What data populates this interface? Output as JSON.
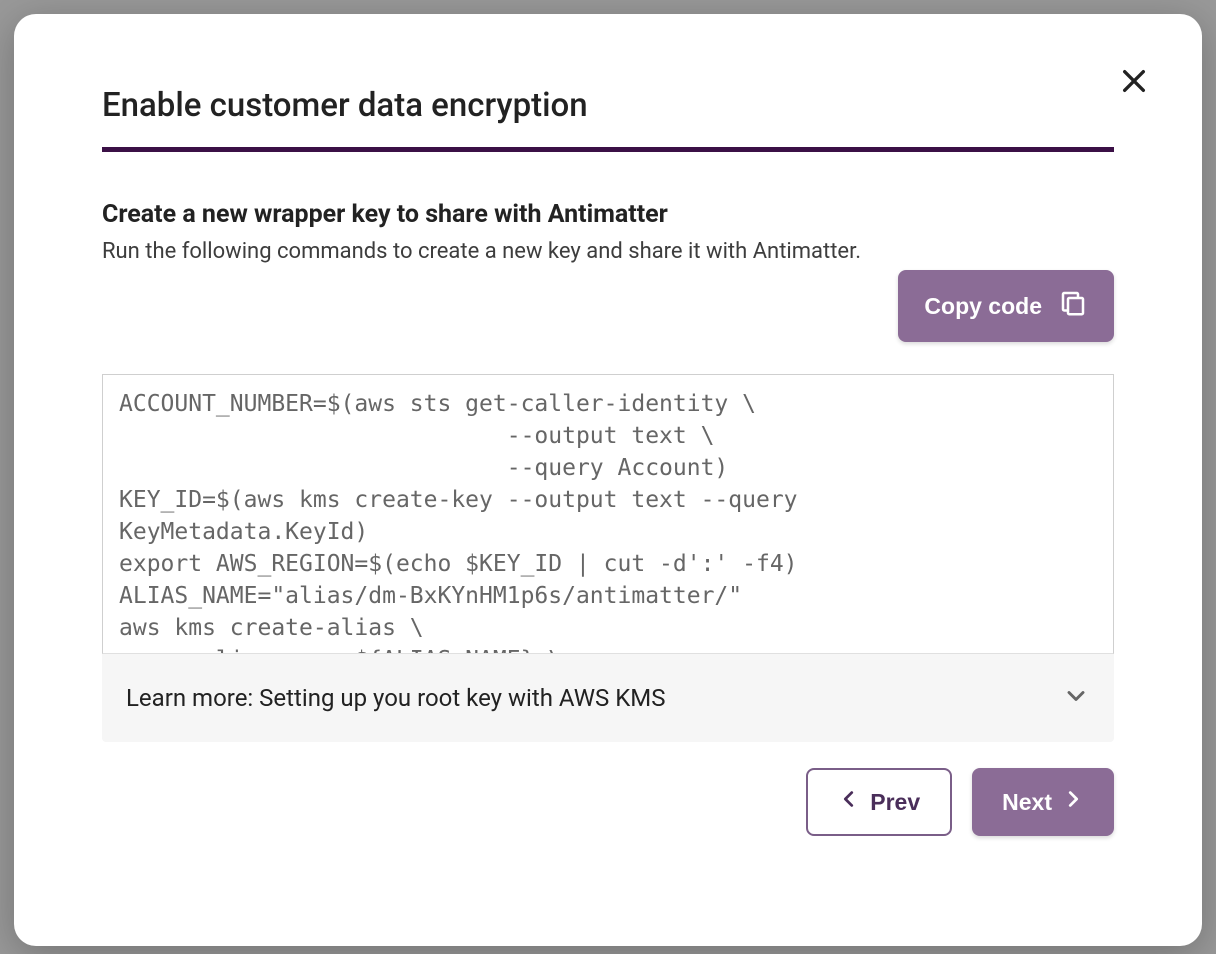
{
  "modal": {
    "title": "Enable customer data encryption",
    "section_heading": "Create a new wrapper key to share with Antimatter",
    "section_sub": "Run the following commands to create a new key and share it with Antimatter.",
    "copy_button": "Copy code",
    "code": "ACCOUNT_NUMBER=$(aws sts get-caller-identity \\\n                            --output text \\\n                            --query Account)\nKEY_ID=$(aws kms create-key --output text --query\nKeyMetadata.KeyId)\nexport AWS_REGION=$(echo $KEY_ID | cut -d':' -f4)\nALIAS_NAME=\"alias/dm-BxKYnHM1p6s/antimatter/\"\naws kms create-alias \\\n      alias name ${ALIAS_NAME} \\",
    "accordion_label": "Learn more: Setting up you root key with AWS KMS",
    "prev_label": "Prev",
    "next_label": "Next"
  }
}
